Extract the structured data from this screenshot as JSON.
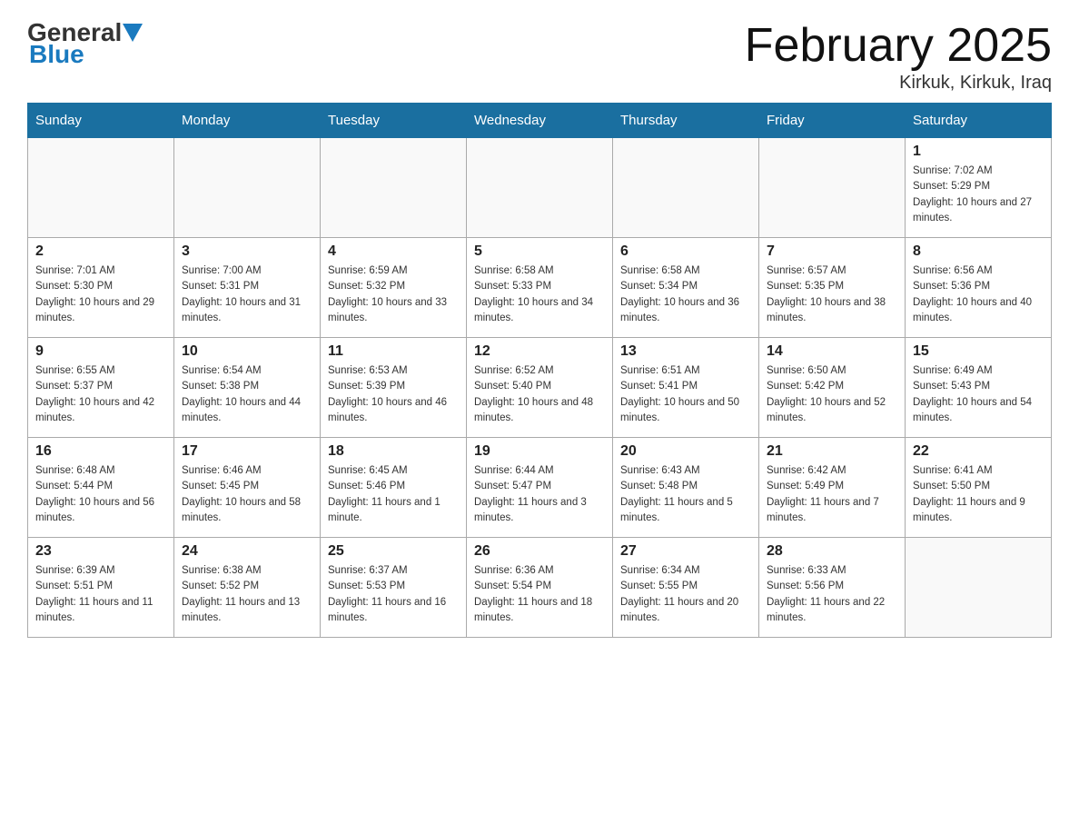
{
  "header": {
    "logo_general": "General",
    "logo_blue": "Blue",
    "month_title": "February 2025",
    "location": "Kirkuk, Kirkuk, Iraq"
  },
  "days_of_week": [
    "Sunday",
    "Monday",
    "Tuesday",
    "Wednesday",
    "Thursday",
    "Friday",
    "Saturday"
  ],
  "weeks": [
    [
      {
        "num": "",
        "info": ""
      },
      {
        "num": "",
        "info": ""
      },
      {
        "num": "",
        "info": ""
      },
      {
        "num": "",
        "info": ""
      },
      {
        "num": "",
        "info": ""
      },
      {
        "num": "",
        "info": ""
      },
      {
        "num": "1",
        "info": "Sunrise: 7:02 AM\nSunset: 5:29 PM\nDaylight: 10 hours and 27 minutes."
      }
    ],
    [
      {
        "num": "2",
        "info": "Sunrise: 7:01 AM\nSunset: 5:30 PM\nDaylight: 10 hours and 29 minutes."
      },
      {
        "num": "3",
        "info": "Sunrise: 7:00 AM\nSunset: 5:31 PM\nDaylight: 10 hours and 31 minutes."
      },
      {
        "num": "4",
        "info": "Sunrise: 6:59 AM\nSunset: 5:32 PM\nDaylight: 10 hours and 33 minutes."
      },
      {
        "num": "5",
        "info": "Sunrise: 6:58 AM\nSunset: 5:33 PM\nDaylight: 10 hours and 34 minutes."
      },
      {
        "num": "6",
        "info": "Sunrise: 6:58 AM\nSunset: 5:34 PM\nDaylight: 10 hours and 36 minutes."
      },
      {
        "num": "7",
        "info": "Sunrise: 6:57 AM\nSunset: 5:35 PM\nDaylight: 10 hours and 38 minutes."
      },
      {
        "num": "8",
        "info": "Sunrise: 6:56 AM\nSunset: 5:36 PM\nDaylight: 10 hours and 40 minutes."
      }
    ],
    [
      {
        "num": "9",
        "info": "Sunrise: 6:55 AM\nSunset: 5:37 PM\nDaylight: 10 hours and 42 minutes."
      },
      {
        "num": "10",
        "info": "Sunrise: 6:54 AM\nSunset: 5:38 PM\nDaylight: 10 hours and 44 minutes."
      },
      {
        "num": "11",
        "info": "Sunrise: 6:53 AM\nSunset: 5:39 PM\nDaylight: 10 hours and 46 minutes."
      },
      {
        "num": "12",
        "info": "Sunrise: 6:52 AM\nSunset: 5:40 PM\nDaylight: 10 hours and 48 minutes."
      },
      {
        "num": "13",
        "info": "Sunrise: 6:51 AM\nSunset: 5:41 PM\nDaylight: 10 hours and 50 minutes."
      },
      {
        "num": "14",
        "info": "Sunrise: 6:50 AM\nSunset: 5:42 PM\nDaylight: 10 hours and 52 minutes."
      },
      {
        "num": "15",
        "info": "Sunrise: 6:49 AM\nSunset: 5:43 PM\nDaylight: 10 hours and 54 minutes."
      }
    ],
    [
      {
        "num": "16",
        "info": "Sunrise: 6:48 AM\nSunset: 5:44 PM\nDaylight: 10 hours and 56 minutes."
      },
      {
        "num": "17",
        "info": "Sunrise: 6:46 AM\nSunset: 5:45 PM\nDaylight: 10 hours and 58 minutes."
      },
      {
        "num": "18",
        "info": "Sunrise: 6:45 AM\nSunset: 5:46 PM\nDaylight: 11 hours and 1 minute."
      },
      {
        "num": "19",
        "info": "Sunrise: 6:44 AM\nSunset: 5:47 PM\nDaylight: 11 hours and 3 minutes."
      },
      {
        "num": "20",
        "info": "Sunrise: 6:43 AM\nSunset: 5:48 PM\nDaylight: 11 hours and 5 minutes."
      },
      {
        "num": "21",
        "info": "Sunrise: 6:42 AM\nSunset: 5:49 PM\nDaylight: 11 hours and 7 minutes."
      },
      {
        "num": "22",
        "info": "Sunrise: 6:41 AM\nSunset: 5:50 PM\nDaylight: 11 hours and 9 minutes."
      }
    ],
    [
      {
        "num": "23",
        "info": "Sunrise: 6:39 AM\nSunset: 5:51 PM\nDaylight: 11 hours and 11 minutes."
      },
      {
        "num": "24",
        "info": "Sunrise: 6:38 AM\nSunset: 5:52 PM\nDaylight: 11 hours and 13 minutes."
      },
      {
        "num": "25",
        "info": "Sunrise: 6:37 AM\nSunset: 5:53 PM\nDaylight: 11 hours and 16 minutes."
      },
      {
        "num": "26",
        "info": "Sunrise: 6:36 AM\nSunset: 5:54 PM\nDaylight: 11 hours and 18 minutes."
      },
      {
        "num": "27",
        "info": "Sunrise: 6:34 AM\nSunset: 5:55 PM\nDaylight: 11 hours and 20 minutes."
      },
      {
        "num": "28",
        "info": "Sunrise: 6:33 AM\nSunset: 5:56 PM\nDaylight: 11 hours and 22 minutes."
      },
      {
        "num": "",
        "info": ""
      }
    ]
  ]
}
